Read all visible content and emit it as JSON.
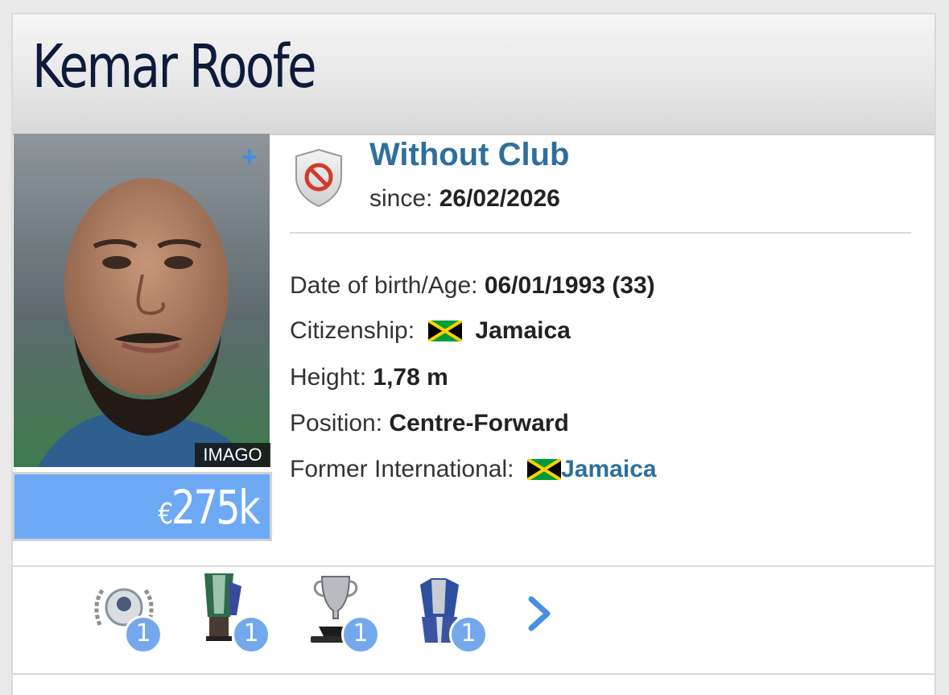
{
  "player": {
    "name": "Kemar Roofe",
    "photo_credit": "IMAGO",
    "market_value_currency": "€",
    "market_value_amount": "275k"
  },
  "club": {
    "name": "Without Club",
    "since_label": "since:",
    "since_date": "26/02/2026"
  },
  "details": {
    "dob_label": "Date of birth/Age:",
    "dob_value": "06/01/1993 (33)",
    "citizenship_label": "Citizenship:",
    "citizenship_value": "Jamaica",
    "height_label": "Height:",
    "height_value": "1,78 m",
    "position_label": "Position:",
    "position_value": "Centre-Forward",
    "international_label": "Former International:",
    "international_value": "Jamaica"
  },
  "trophies": [
    {
      "icon": "laurel-badge-icon",
      "count": "1"
    },
    {
      "icon": "league-cup-icon",
      "count": "1"
    },
    {
      "icon": "silver-cup-icon",
      "count": "1"
    },
    {
      "icon": "trophy-cup-icon",
      "count": "1"
    }
  ],
  "colors": {
    "accent_blue": "#2e6f9e",
    "value_box": "#6ea9f6",
    "badge": "#74a8ec"
  }
}
